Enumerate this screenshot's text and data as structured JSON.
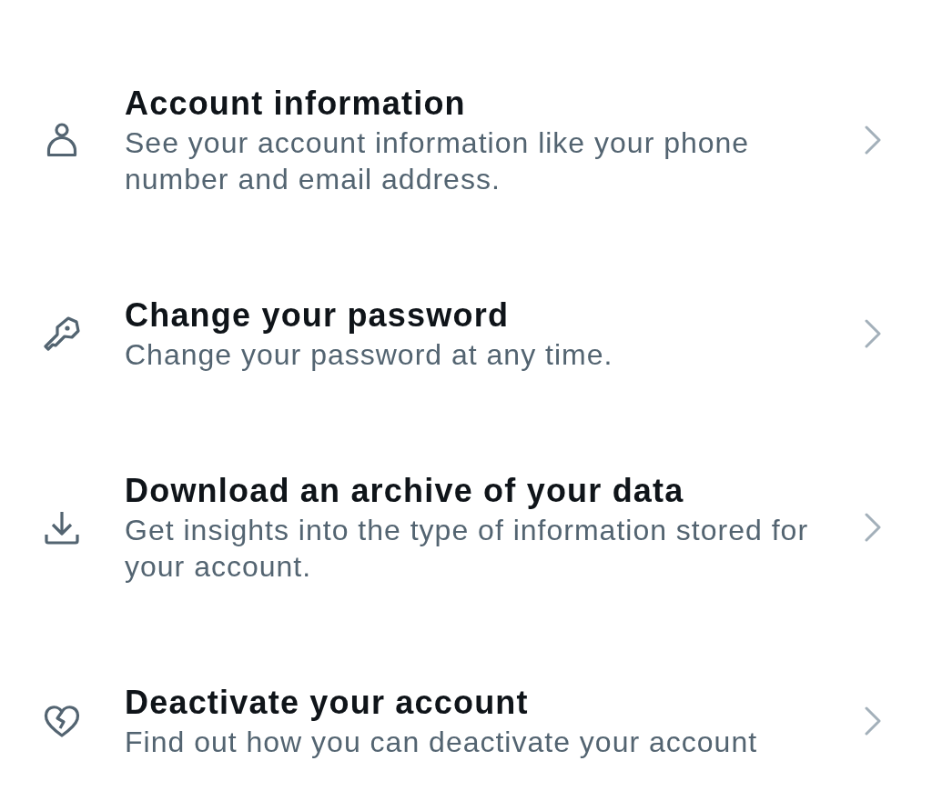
{
  "items": [
    {
      "title": "Account information",
      "description": "See your account information like your phone number and email address."
    },
    {
      "title": "Change your password",
      "description": "Change your password at any time."
    },
    {
      "title": "Download an archive of your data",
      "description": "Get insights into the type of information stored for your account."
    },
    {
      "title": "Deactivate your account",
      "description": "Find out how you can deactivate your account"
    }
  ]
}
